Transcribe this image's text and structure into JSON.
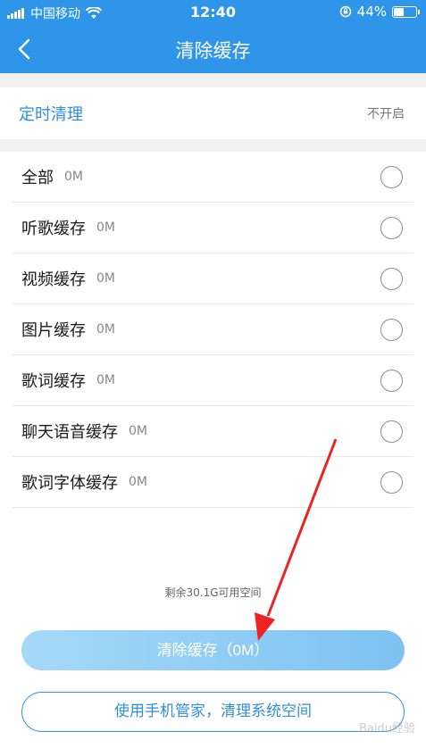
{
  "status_bar": {
    "carrier": "中国移动",
    "time": "12:40",
    "battery": "44%",
    "battery_level": 0.44,
    "icons": [
      "signal-icon",
      "wifi-icon",
      "rotation-lock-icon",
      "battery-icon"
    ]
  },
  "header": {
    "title": "清除缓存",
    "back_icon": "chevron-left-icon",
    "color": "#2f95e8"
  },
  "timer": {
    "label": "定时清理",
    "value": "不开启"
  },
  "cache_items": [
    {
      "label": "全部",
      "size": "0M"
    },
    {
      "label": "听歌缓存",
      "size": "0M"
    },
    {
      "label": "视频缓存",
      "size": "0M"
    },
    {
      "label": "图片缓存",
      "size": "0M"
    },
    {
      "label": "歌词缓存",
      "size": "0M"
    },
    {
      "label": "聊天语音缓存",
      "size": "0M"
    },
    {
      "label": "歌词字体缓存",
      "size": "0M"
    }
  ],
  "footer": {
    "space_info": "剩余30.1G可用空间",
    "clear_button": "清除缓存（0M）",
    "manager_button": "使用手机管家，清理系统空间"
  },
  "annotation": {
    "arrow_color": "#ee2222"
  },
  "watermark": "Baidu经验"
}
